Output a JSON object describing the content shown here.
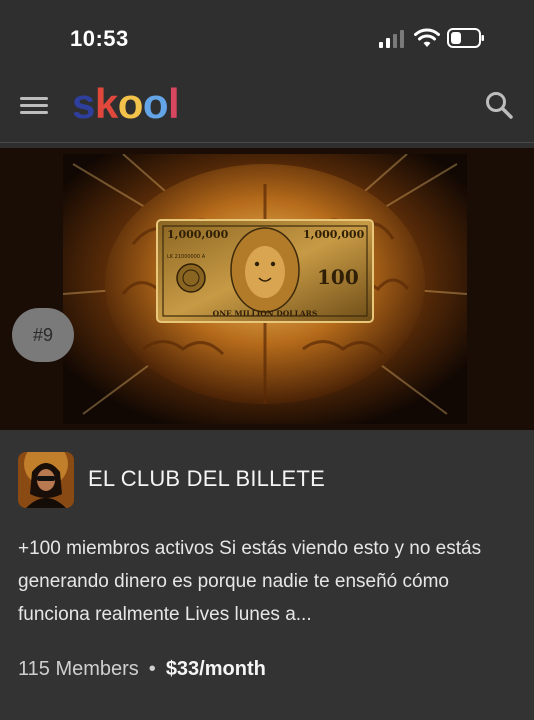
{
  "status_bar": {
    "time": "10:53",
    "icons": [
      "signal-icon",
      "wifi-icon",
      "battery-icon"
    ]
  },
  "header": {
    "logo": {
      "letters": [
        "s",
        "k",
        "o",
        "o",
        "l"
      ],
      "colors": [
        "#2e3f9e",
        "#e0483c",
        "#f2c24a",
        "#64a5e8",
        "#d9465f"
      ]
    },
    "menu_icon": "hamburger-icon",
    "search_icon": "search-icon"
  },
  "card": {
    "rank": "#9",
    "image": {
      "banknote_top_left": "1,000,000",
      "banknote_top_right": "1,000,000",
      "banknote_bottom": "ONE MILLION DOLLARS",
      "banknote_serial": "LK 21000000 A",
      "banknote_center_num": "100"
    },
    "group_name": "EL CLUB DEL BILLETE",
    "description": "+100 miembros activos Si estás viendo esto y no estás generando dinero es porque nadie te enseñó cómo funciona realmente Lives lunes a...",
    "members": "115 Members",
    "separator": "•",
    "price": "$33/month"
  }
}
